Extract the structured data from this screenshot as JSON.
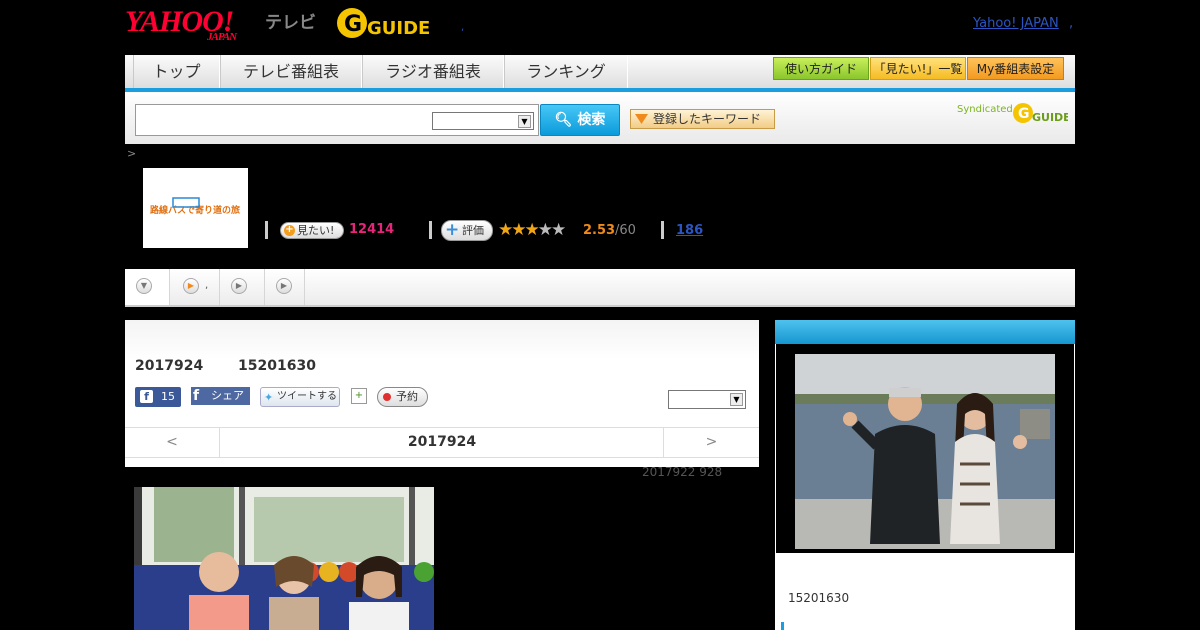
{
  "header": {
    "yahoo_logo": "YAHOO!",
    "yahoo_sub": "JAPAN",
    "tv_label": "テレビ",
    "gguide_logo": "G GUIDE",
    "yahoo_japan_link": "Yahoo! JAPAN",
    "link_dot": ",",
    "header_dot": ","
  },
  "nav": {
    "tabs": [
      "トップ",
      "テレビ番組表",
      "ラジオ番組表",
      "ランキング"
    ],
    "guide_button": "使い方ガイド",
    "want_list_button": "「見たい!」一覧",
    "my_schedule_button": "My番組表設定"
  },
  "search": {
    "input_value": "",
    "select_value": "",
    "button_label": "検索",
    "keyword_button": "登録したキーワード",
    "syndicated": "Syndicated",
    "syndicated_logo": "G GUIDE"
  },
  "breadcrumb": ">",
  "program": {
    "thumb_title": "路線バスで寄り道の旅",
    "want_label": "見たい!",
    "want_count": "12414",
    "rate_label": "評価",
    "stars": "★★★★★",
    "rating": 2.53,
    "rating_text": "2.53",
    "rating_total": "/60",
    "comment_count": "186"
  },
  "subtabs": {
    "tab2_suffix": ","
  },
  "episode": {
    "date": "2017924",
    "time": "15201630",
    "fb_count": "15",
    "fb_share": "シェア",
    "tweet": "ツイートする",
    "reserve": "予約",
    "panel_select_value": "",
    "prev": "<",
    "date_title": "2017924",
    "next": ">",
    "update_note": "2017922  928"
  },
  "side": {
    "time": "15201630"
  },
  "colors": {
    "accent_blue": "#1a9ee0",
    "want_pink": "#e4267a",
    "rating_orange": "#f08a1c",
    "link_blue": "#2b55c2"
  }
}
